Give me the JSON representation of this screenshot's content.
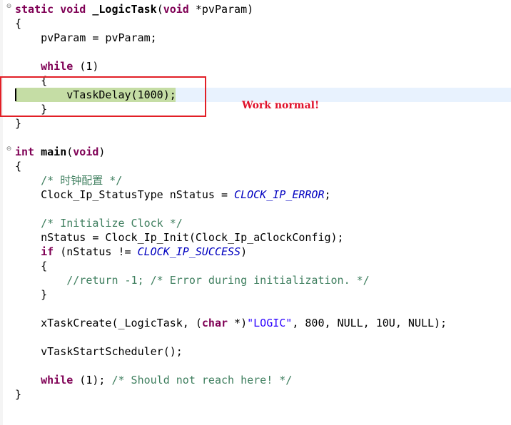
{
  "code": {
    "l01": {
      "kw1": "static",
      "kw2": "void",
      "fn": "_LogicTask",
      "p1": "(",
      "kw3": "void",
      "p2": " *pvParam)"
    },
    "l02": "{",
    "l03": "    pvParam = pvParam;",
    "l05": {
      "kw": "while",
      "rest": " (1)"
    },
    "l06": "    {",
    "l07": "        vTaskDelay(1000);",
    "l08": "    }",
    "l09": "}",
    "l11": {
      "kw1": "int",
      "fn": "main",
      "p1": "(",
      "kw2": "void",
      "p2": ")"
    },
    "l12": "{",
    "l13": "    /* 时钟配置 */",
    "l14": {
      "a": "    Clock_Ip_StatusType nStatus = ",
      "en": "CLOCK_IP_ERROR",
      "b": ";"
    },
    "l16": "    /* Initialize Clock */",
    "l17": "    nStatus = Clock_Ip_Init(Clock_Ip_aClockConfig);",
    "l18": {
      "kw": "if",
      "a": " (nStatus != ",
      "en": "CLOCK_IP_SUCCESS",
      "b": ")"
    },
    "l19": "    {",
    "l20": "        //return -1; /* Error during initialization. */",
    "l21": "    }",
    "l23": {
      "a": "    xTaskCreate(_LogicTask, (",
      "kw": "char",
      "b": " *)",
      "str": "\"LOGIC\"",
      "c": ", 800, NULL, 10U, NULL);"
    },
    "l25": "    vTaskStartScheduler();",
    "l27": {
      "kw": "while",
      "a": " (1); ",
      "cm": "/* Should not reach here! */"
    },
    "l28": "}"
  },
  "fold_icons": [
    "collapse-icon",
    "collapse-icon"
  ],
  "fold_glyph": "⊖",
  "annotation": "Work normal!",
  "colors": {
    "keyword": "#7f0055",
    "comment": "#3f7f5f",
    "string": "#2a00ff",
    "enum": "#0000c0",
    "highlight": "#c5dda5",
    "current_line": "#e8f2fe",
    "red_box": "#e21f26",
    "annotation": "#e0102a"
  }
}
